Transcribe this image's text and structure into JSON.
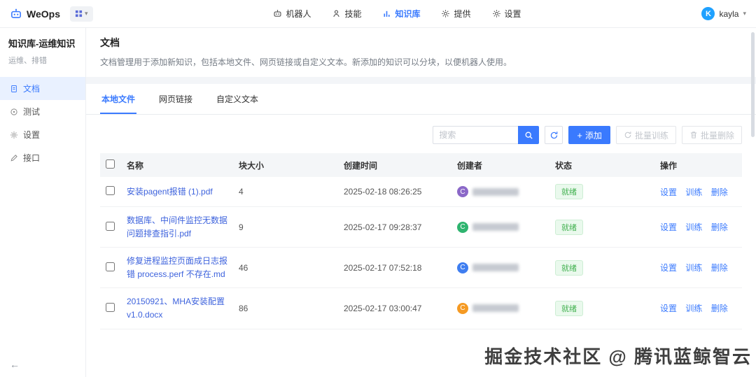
{
  "topnav": {
    "logo": "WeOps",
    "items": [
      {
        "label": "机器人"
      },
      {
        "label": "技能"
      },
      {
        "label": "知识库"
      },
      {
        "label": "提供"
      },
      {
        "label": "设置"
      }
    ],
    "user": {
      "name": "kayla",
      "avatar_letter": "K"
    }
  },
  "sidebar": {
    "title": "知识库-运维知识",
    "subtitle": "运维、排错",
    "items": [
      {
        "label": "文档"
      },
      {
        "label": "测试"
      },
      {
        "label": "设置"
      },
      {
        "label": "接口"
      }
    ],
    "collapse_icon": "←"
  },
  "page": {
    "title": "文档",
    "description": "文档管理用于添加新知识，包括本地文件、网页链接或自定义文本。新添加的知识可以分块，以便机器人使用。"
  },
  "tabs": [
    {
      "label": "本地文件"
    },
    {
      "label": "网页链接"
    },
    {
      "label": "自定义文本"
    }
  ],
  "toolbar": {
    "search_placeholder": "搜索",
    "add_label": "添加",
    "batch_train_label": "批量训练",
    "batch_delete_label": "批量删除"
  },
  "table": {
    "headers": {
      "name": "名称",
      "chunk": "块大小",
      "created": "创建时间",
      "creator": "创建者",
      "status": "状态",
      "actions": "操作"
    },
    "actions": {
      "settings": "设置",
      "train": "训练",
      "delete": "删除"
    },
    "rows": [
      {
        "name": "安装pagent报错 (1).pdf",
        "chunk": "4",
        "created": "2025-02-18 08:26:25",
        "creator_letter": "C",
        "creator_color": "#8b68c8",
        "status": "就绪"
      },
      {
        "name": "数据库、中间件监控无数据问题排查指引.pdf",
        "chunk": "9",
        "created": "2025-02-17 09:28:37",
        "creator_letter": "C",
        "creator_color": "#2fb46f",
        "status": "就绪"
      },
      {
        "name": "修复进程监控页面成日志报错 process.perf 不存在.md",
        "chunk": "46",
        "created": "2025-02-17 07:52:18",
        "creator_letter": "C",
        "creator_color": "#3f7ef0",
        "status": "就绪"
      },
      {
        "name": "20150921、MHA安装配置v1.0.docx",
        "chunk": "86",
        "created": "2025-02-17 03:00:47",
        "creator_letter": "C",
        "creator_color": "#f59a23",
        "status": "就绪"
      }
    ]
  },
  "watermark": "掘金技术社区 @ 腾讯蓝鲸智云",
  "colors": {
    "primary": "#3a7afe",
    "link": "#3e63dd",
    "status_green": "#41b14f"
  }
}
